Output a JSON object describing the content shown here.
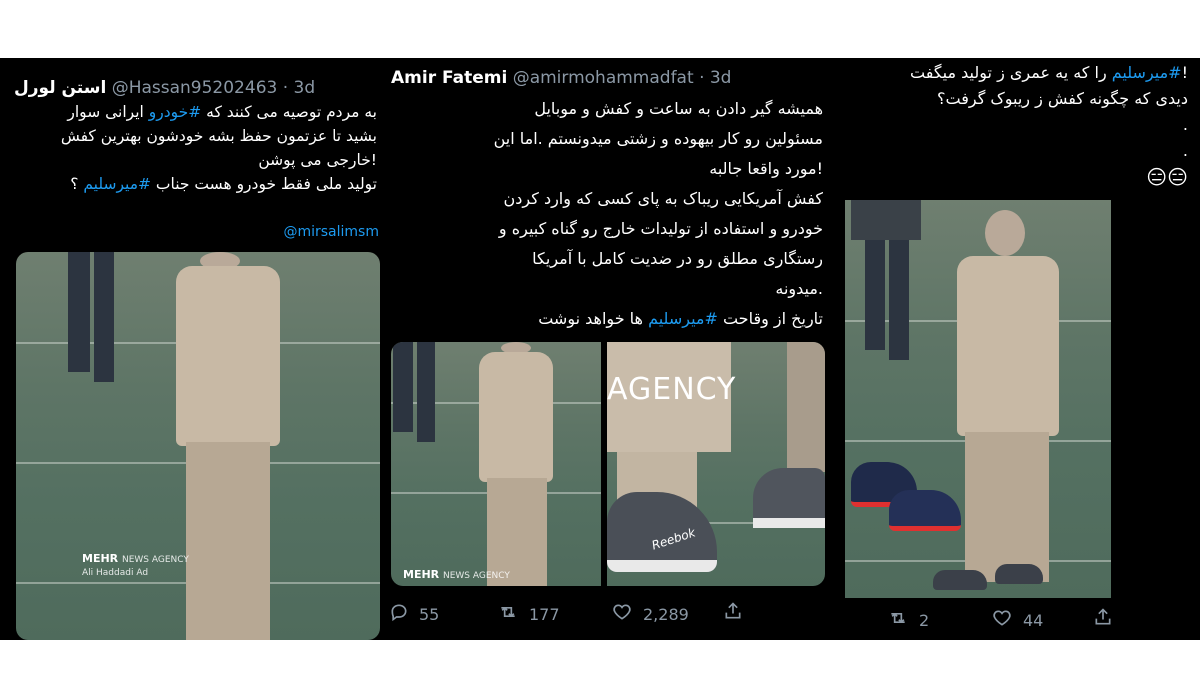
{
  "tweet1": {
    "display_name": "استن لورل",
    "handle": "@Hassan95202463",
    "time": "· 3d",
    "lines": [
      "به مردم توصیه می کنند که ",
      "بشید تا عزتمون حفظ بشه خودشون بهترین کفش",
      "!خارجی می پوشن",
      "تولید ملی فقط خودرو هست جناب "
    ],
    "tag_khodro": "#خودرو",
    "line1_tail": " ایرانی سوار",
    "tag_mirsalim": "#میرسلیم",
    "line4_tail": " ؟",
    "mention": "@mirsalimsm",
    "watermark": "MEHR",
    "watermark_sub": "NEWS AGENCY",
    "watermark_credit": "Ali Haddadi Ad"
  },
  "tweet2": {
    "display_name": "Amir Fatemi",
    "handle": "@amirmohammadfat",
    "time": "· 3d",
    "lines": [
      "همیشه گیر دادن به ساعت و کفش و موبایل",
      "مسئولین رو کار بیهوده و زشتی میدونستم .اما این",
      "!مورد واقعا جالبه",
      "کفش آمریکایی ریباک به پای کسی که وارد کردن",
      "خودرو و استفاده از تولیدات خارج رو گناه کبیره و",
      "رستگاری مطلق رو در ضدیت کامل با آمریکا",
      ".میدونه"
    ],
    "last_line_pre": "تاریخ از وقاحت ",
    "tag_mirsalim": "#میرسلیم",
    "last_line_post": " ها خواهد نوشت",
    "watermark": "MEHR",
    "watermark_sub": "NEWS AGENCY",
    "agency_text": "AGENCY",
    "shoe_brand": "Reebok",
    "replies": "55",
    "retweets": "177",
    "likes": "2,289"
  },
  "tweet3": {
    "line1_pre": "!",
    "tag_mirsalim": "#میرسلیم",
    "line1_post": " را که یه عمری ز تولید میگفت",
    "line2": "دیدی  که  چگونه کفش ز ریبوک گرفت؟",
    "dot1": ".",
    "dot2": ".",
    "emoji": "😑😑",
    "retweets": "2",
    "likes": "44"
  },
  "icons": {
    "reply": "reply-icon",
    "retweet": "retweet-icon",
    "like": "heart-icon",
    "share": "share-icon"
  },
  "colors": {
    "hashtag": "#1d9bf0",
    "muted": "#8b98a5",
    "background": "#000000"
  }
}
